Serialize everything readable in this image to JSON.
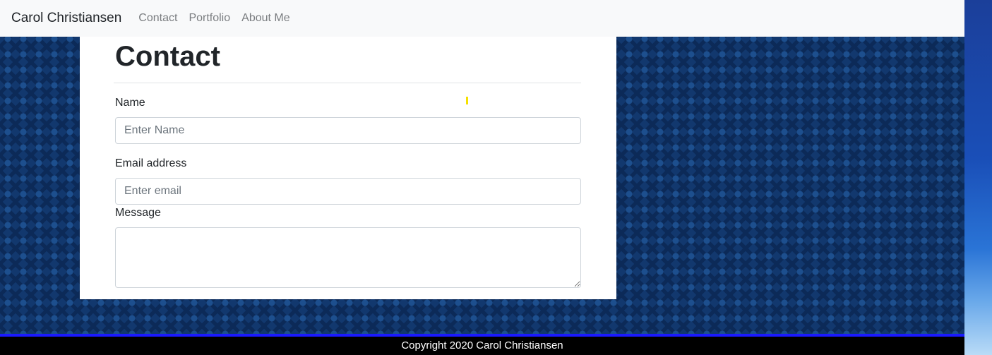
{
  "navbar": {
    "brand": "Carol Christiansen",
    "links": [
      "Contact",
      "Portfolio",
      "About Me"
    ]
  },
  "contact": {
    "heading": "Contact",
    "name_label": "Name",
    "name_placeholder": "Enter Name",
    "email_label": "Email address",
    "email_placeholder": "Enter email",
    "message_label": "Message"
  },
  "footer": {
    "text": "Copyright 2020 Carol Christiansen"
  },
  "colors": {
    "navbar_bg": "#f8f9fa",
    "page_bg": "#12386e",
    "footer_bg": "#000000",
    "footer_accent": "#1a1aff"
  }
}
